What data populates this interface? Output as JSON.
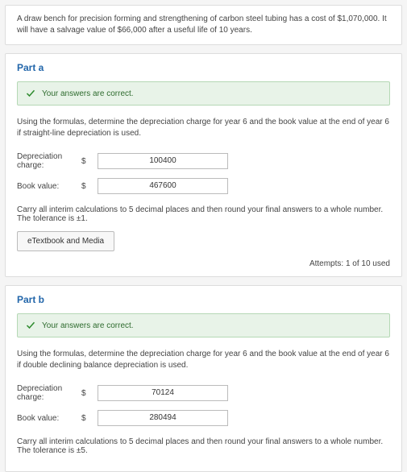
{
  "problem": {
    "text": "A draw bench for precision forming and strengthening of carbon steel tubing has a cost of $1,070,000. It will have a salvage value of $66,000 after a useful life of 10 years."
  },
  "partA": {
    "title": "Part a",
    "correct_msg": "Your answers are correct.",
    "instructions": "Using the formulas, determine the depreciation charge for year 6 and the book value at the end of year 6 if straight-line depreciation is used.",
    "dep_label": "Depreciation charge:",
    "dep_currency": "$",
    "dep_value": "100400",
    "bv_label": "Book value:",
    "bv_currency": "$",
    "bv_value": "467600",
    "note": "Carry all interim calculations to 5 decimal places and then round your final answers to a whole number. The tolerance is ±1.",
    "etext_label": "eTextbook and Media",
    "attempts": "Attempts: 1 of 10 used"
  },
  "partB": {
    "title": "Part b",
    "correct_msg": "Your answers are correct.",
    "instructions": "Using the formulas, determine the depreciation charge for year 6 and the book value at the end of year 6 if double declining balance depreciation is used.",
    "dep_label": "Depreciation charge:",
    "dep_currency": "$",
    "dep_value": "70124",
    "bv_label": "Book value:",
    "bv_currency": "$",
    "bv_value": "280494",
    "note": "Carry all interim calculations to 5 decimal places and then round your final answers to a whole number. The tolerance is ±5."
  }
}
